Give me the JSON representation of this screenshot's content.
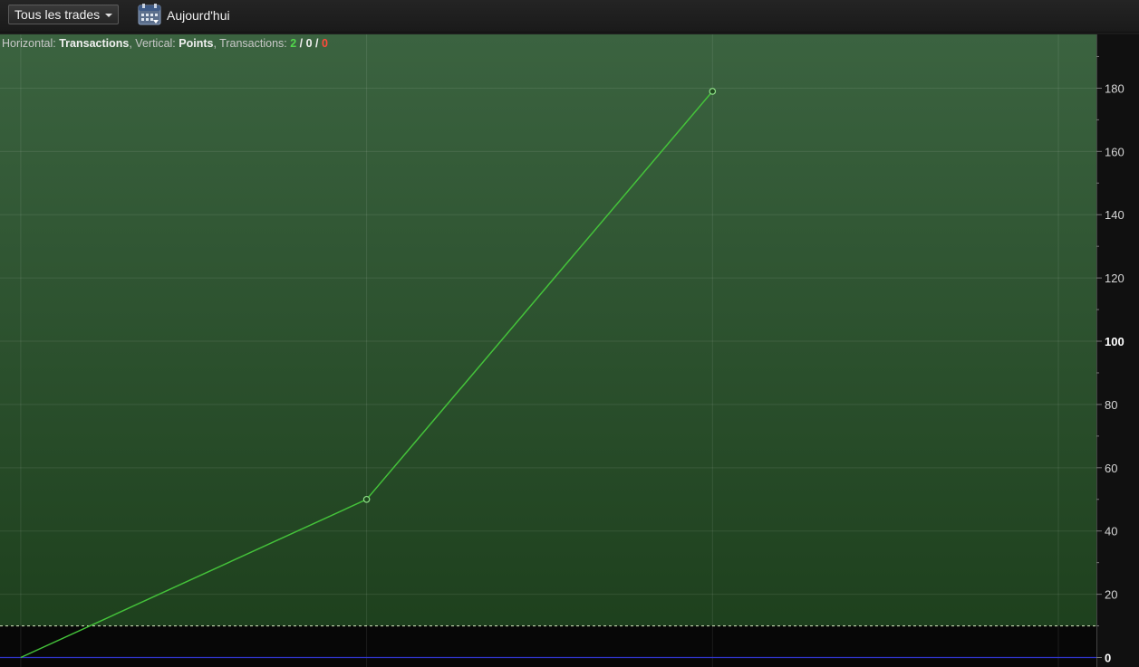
{
  "toolbar": {
    "filter_label": "Tous les trades",
    "date_label": "Aujourd'hui"
  },
  "info": {
    "h_prefix": "Horizontal: ",
    "h_value": "Transactions",
    "v_prefix": ", Vertical: ",
    "v_value": "Points",
    "t_prefix": ", Transactions: ",
    "t_win": "2",
    "sep1": " / ",
    "t_even": "0",
    "sep2": " / ",
    "t_loss": "0"
  },
  "chart_data": {
    "type": "line",
    "x": [
      0,
      1,
      2
    ],
    "y": [
      0,
      50,
      179
    ],
    "xlim": [
      -0.06,
      3.11
    ],
    "ylim": [
      -3,
      197
    ],
    "y_ticks": [
      0,
      20,
      40,
      60,
      80,
      100,
      120,
      140,
      160,
      180
    ],
    "y_bold_ticks": [
      0,
      100
    ],
    "x_gridlines": [
      0,
      1,
      2,
      3
    ],
    "threshold_value": 10,
    "baseline_value": 0,
    "grid": true,
    "y_axis_side": "right",
    "colors": {
      "line": "#44c23a",
      "marker_fill": "#1f4a1f",
      "bg_top": "#3b6340",
      "bg_bottom": "#1c3e1b",
      "below_threshold": "#070707",
      "threshold": "#d8e8c0",
      "baseline": "#2f34c8",
      "axis_bg": "#101010"
    }
  }
}
